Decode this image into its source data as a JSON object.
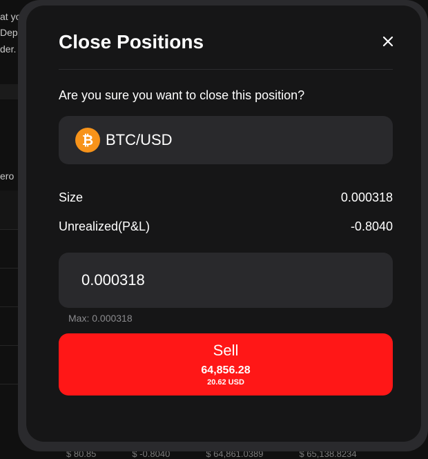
{
  "background": {
    "fragments": [
      "at yo",
      "Dep",
      "der.",
      "ero"
    ],
    "bottom_row": [
      "$ 80.85",
      "$ -0.8040",
      "$ 64,861.0389",
      "$ 65,138.8234"
    ]
  },
  "modal": {
    "title": "Close Positions",
    "close_icon": "close-icon",
    "question": "Are you sure you want to close this position?",
    "asset": {
      "icon": "bitcoin-icon",
      "name": "BTC/USD"
    },
    "size": {
      "label": "Size",
      "value": "0.000318"
    },
    "pnl": {
      "label": "Unrealized(P&L)",
      "value": "-0.8040"
    },
    "amount_input": {
      "value": "0.000318"
    },
    "max_label": "Max: 0.000318",
    "sell_button": {
      "label": "Sell",
      "price": "64,856.28",
      "usd": "20.62 USD"
    }
  },
  "colors": {
    "sell_button": "#ff1717",
    "bitcoin": "#f7931a",
    "panel": "#161617",
    "field": "#29292c"
  }
}
